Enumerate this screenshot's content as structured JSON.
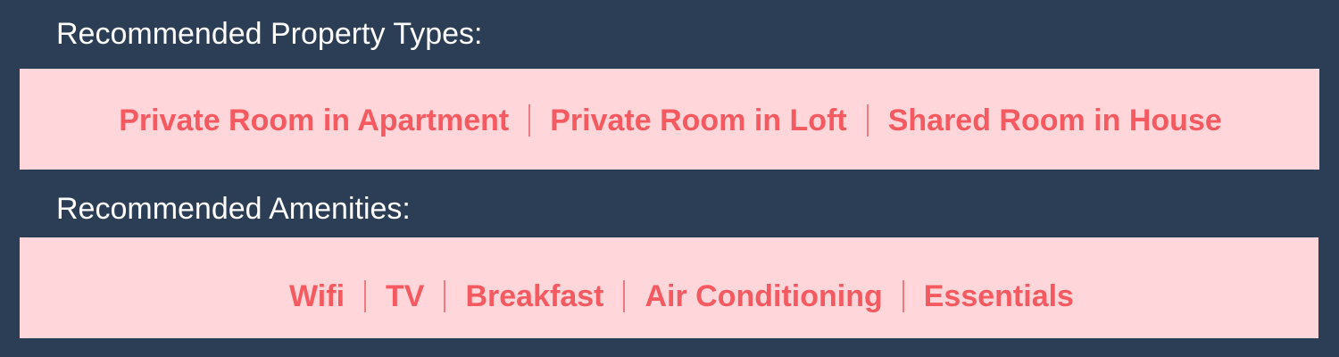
{
  "property_section": {
    "title": "Recommended Property Types:",
    "items": [
      "Private Room in Apartment",
      "Private Room in Loft",
      "Shared Room in House"
    ]
  },
  "amenities_section": {
    "title": "Recommended Amenities:",
    "items": [
      "Wifi",
      "TV",
      "Breakfast",
      "Air Conditioning",
      "Essentials"
    ]
  },
  "colors": {
    "background": "#2c3e55",
    "panel_background": "#ffd7db",
    "item_text": "#f55a60",
    "title_text": "#ffffff"
  }
}
